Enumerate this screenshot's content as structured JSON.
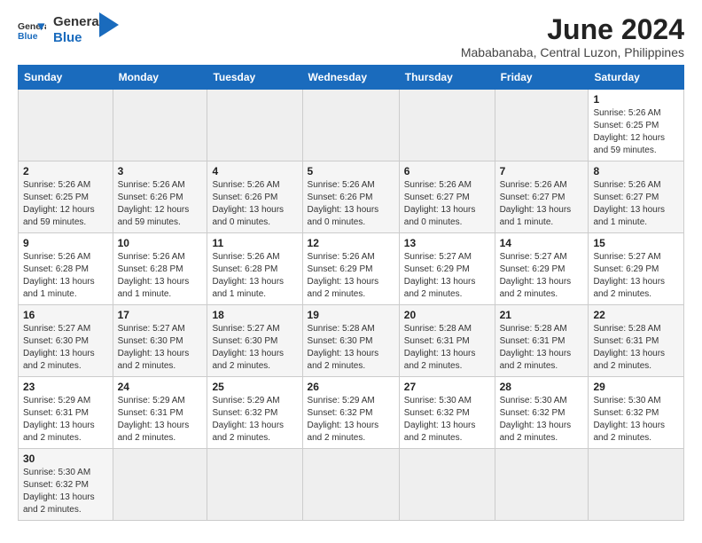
{
  "header": {
    "logo_text_general": "General",
    "logo_text_blue": "Blue",
    "month_title": "June 2024",
    "location": "Mababanaba, Central Luzon, Philippines"
  },
  "weekdays": [
    "Sunday",
    "Monday",
    "Tuesday",
    "Wednesday",
    "Thursday",
    "Friday",
    "Saturday"
  ],
  "weeks": [
    [
      {
        "day": "",
        "info": ""
      },
      {
        "day": "",
        "info": ""
      },
      {
        "day": "",
        "info": ""
      },
      {
        "day": "",
        "info": ""
      },
      {
        "day": "",
        "info": ""
      },
      {
        "day": "",
        "info": ""
      },
      {
        "day": "1",
        "info": "Sunrise: 5:26 AM\nSunset: 6:25 PM\nDaylight: 12 hours and 59 minutes."
      }
    ],
    [
      {
        "day": "2",
        "info": "Sunrise: 5:26 AM\nSunset: 6:25 PM\nDaylight: 12 hours and 59 minutes."
      },
      {
        "day": "3",
        "info": "Sunrise: 5:26 AM\nSunset: 6:26 PM\nDaylight: 12 hours and 59 minutes."
      },
      {
        "day": "4",
        "info": "Sunrise: 5:26 AM\nSunset: 6:26 PM\nDaylight: 13 hours and 0 minutes."
      },
      {
        "day": "5",
        "info": "Sunrise: 5:26 AM\nSunset: 6:26 PM\nDaylight: 13 hours and 0 minutes."
      },
      {
        "day": "6",
        "info": "Sunrise: 5:26 AM\nSunset: 6:27 PM\nDaylight: 13 hours and 0 minutes."
      },
      {
        "day": "7",
        "info": "Sunrise: 5:26 AM\nSunset: 6:27 PM\nDaylight: 13 hours and 1 minute."
      },
      {
        "day": "8",
        "info": "Sunrise: 5:26 AM\nSunset: 6:27 PM\nDaylight: 13 hours and 1 minute."
      }
    ],
    [
      {
        "day": "9",
        "info": "Sunrise: 5:26 AM\nSunset: 6:28 PM\nDaylight: 13 hours and 1 minute."
      },
      {
        "day": "10",
        "info": "Sunrise: 5:26 AM\nSunset: 6:28 PM\nDaylight: 13 hours and 1 minute."
      },
      {
        "day": "11",
        "info": "Sunrise: 5:26 AM\nSunset: 6:28 PM\nDaylight: 13 hours and 1 minute."
      },
      {
        "day": "12",
        "info": "Sunrise: 5:26 AM\nSunset: 6:29 PM\nDaylight: 13 hours and 2 minutes."
      },
      {
        "day": "13",
        "info": "Sunrise: 5:27 AM\nSunset: 6:29 PM\nDaylight: 13 hours and 2 minutes."
      },
      {
        "day": "14",
        "info": "Sunrise: 5:27 AM\nSunset: 6:29 PM\nDaylight: 13 hours and 2 minutes."
      },
      {
        "day": "15",
        "info": "Sunrise: 5:27 AM\nSunset: 6:29 PM\nDaylight: 13 hours and 2 minutes."
      }
    ],
    [
      {
        "day": "16",
        "info": "Sunrise: 5:27 AM\nSunset: 6:30 PM\nDaylight: 13 hours and 2 minutes."
      },
      {
        "day": "17",
        "info": "Sunrise: 5:27 AM\nSunset: 6:30 PM\nDaylight: 13 hours and 2 minutes."
      },
      {
        "day": "18",
        "info": "Sunrise: 5:27 AM\nSunset: 6:30 PM\nDaylight: 13 hours and 2 minutes."
      },
      {
        "day": "19",
        "info": "Sunrise: 5:28 AM\nSunset: 6:30 PM\nDaylight: 13 hours and 2 minutes."
      },
      {
        "day": "20",
        "info": "Sunrise: 5:28 AM\nSunset: 6:31 PM\nDaylight: 13 hours and 2 minutes."
      },
      {
        "day": "21",
        "info": "Sunrise: 5:28 AM\nSunset: 6:31 PM\nDaylight: 13 hours and 2 minutes."
      },
      {
        "day": "22",
        "info": "Sunrise: 5:28 AM\nSunset: 6:31 PM\nDaylight: 13 hours and 2 minutes."
      }
    ],
    [
      {
        "day": "23",
        "info": "Sunrise: 5:29 AM\nSunset: 6:31 PM\nDaylight: 13 hours and 2 minutes."
      },
      {
        "day": "24",
        "info": "Sunrise: 5:29 AM\nSunset: 6:31 PM\nDaylight: 13 hours and 2 minutes."
      },
      {
        "day": "25",
        "info": "Sunrise: 5:29 AM\nSunset: 6:32 PM\nDaylight: 13 hours and 2 minutes."
      },
      {
        "day": "26",
        "info": "Sunrise: 5:29 AM\nSunset: 6:32 PM\nDaylight: 13 hours and 2 minutes."
      },
      {
        "day": "27",
        "info": "Sunrise: 5:30 AM\nSunset: 6:32 PM\nDaylight: 13 hours and 2 minutes."
      },
      {
        "day": "28",
        "info": "Sunrise: 5:30 AM\nSunset: 6:32 PM\nDaylight: 13 hours and 2 minutes."
      },
      {
        "day": "29",
        "info": "Sunrise: 5:30 AM\nSunset: 6:32 PM\nDaylight: 13 hours and 2 minutes."
      }
    ],
    [
      {
        "day": "30",
        "info": "Sunrise: 5:30 AM\nSunset: 6:32 PM\nDaylight: 13 hours and 2 minutes."
      },
      {
        "day": "",
        "info": ""
      },
      {
        "day": "",
        "info": ""
      },
      {
        "day": "",
        "info": ""
      },
      {
        "day": "",
        "info": ""
      },
      {
        "day": "",
        "info": ""
      },
      {
        "day": "",
        "info": ""
      }
    ]
  ]
}
